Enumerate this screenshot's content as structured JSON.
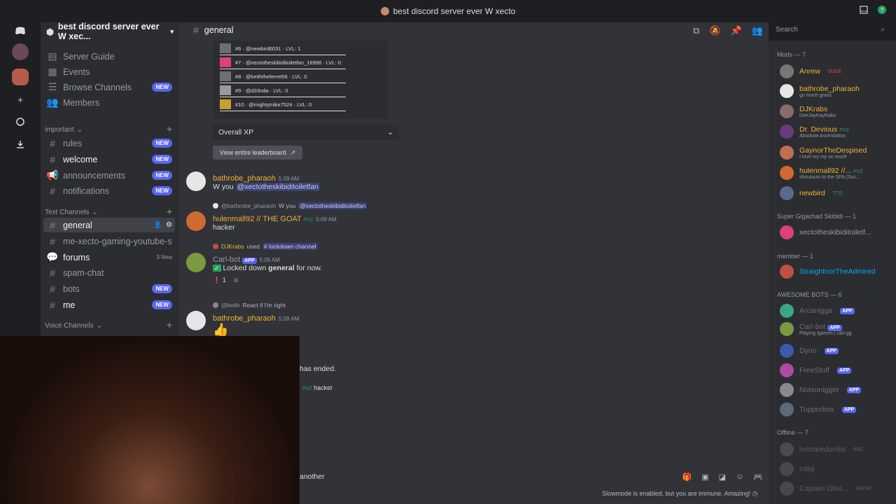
{
  "window": {
    "title": "best discord server ever W xecto"
  },
  "server": {
    "name": "best discord server ever W xec...",
    "items": [
      "Server Guide",
      "Events",
      "Browse Channels",
      "Members"
    ],
    "new_label": "NEW"
  },
  "categories": {
    "important": "important",
    "text": "Text Channels",
    "voice": "Voice Channels"
  },
  "channels": [
    {
      "name": "rules",
      "badge": "NEW"
    },
    {
      "name": "welcome",
      "badge": "NEW"
    },
    {
      "name": "announcements",
      "badge": "NEW"
    },
    {
      "name": "notifications",
      "badge": "NEW"
    },
    {
      "name": "general",
      "badge": ""
    },
    {
      "name": "me-xecto-gaming-youtube-stre...",
      "badge": ""
    },
    {
      "name": "forums",
      "badge": "3 New"
    },
    {
      "name": "spam-chat",
      "badge": ""
    },
    {
      "name": "bots",
      "badge": "NEW"
    },
    {
      "name": "me",
      "badge": "NEW"
    }
  ],
  "header": {
    "channel": "general",
    "search_placeholder": "Search"
  },
  "leaderboard": {
    "rows": [
      "#6 · @newbird6031 · LVL: 1",
      "#7 · @xectotheskibiditoiletfan_16998 · LVL: 0",
      "#8 · @keiththeferret56 · LVL: 0",
      "#9 · @d33nda · LVL: 0",
      "#10 · @mightymike7524 · LVL: 0"
    ],
    "select": "Overall XP",
    "button": "View entire leaderboard"
  },
  "messages": {
    "m1": {
      "user": "bathrobe_pharaoh",
      "time": "5:09 AM",
      "text": "W you",
      "mention": "@xectotheskibiditoiletfan"
    },
    "m2": {
      "reply_user": "@bathrobe_pharaoh",
      "reply_text": "W you",
      "reply_mention": "@xectotheskibiditoiletfan",
      "user": "hulenmall92 // THE GOAT",
      "tag": "PVZ",
      "time": "5:09 AM",
      "text": "hacker"
    },
    "m3": {
      "reply_user": "DJKrabs",
      "reply_used": "used",
      "reply_cmd": "# lockdown channel",
      "user": "Carl-bot",
      "app": "APP",
      "time": "5:09 AM",
      "text_pre": "Locked down",
      "text_bold": "general",
      "text_post": "for now.",
      "reaction": "1"
    },
    "m4": {
      "reply_user": "@keith",
      "reply_text": "React if I'm right",
      "user": "bathrobe_pharaoh",
      "time": "5:09 AM"
    },
    "m5": {
      "text": "has ended."
    },
    "m6": {
      "tag": "PVZ",
      "text": "hacker"
    }
  },
  "composer": {
    "text": "another"
  },
  "slowmode": "Slowmode is enabled, but you are immune. Amazing!",
  "members": {
    "groups": [
      "Mods — 7",
      "Super Gigachad Skibidi — 1",
      "member — 1",
      "AWESOME BOTS — 6",
      "Offline — 7"
    ],
    "mods": [
      {
        "name": "Anrew",
        "extra": "DUDE",
        "color": "#f0b232",
        "sub": ""
      },
      {
        "name": "bathrobe_pharaoh",
        "extra": "",
        "color": "#f0b232",
        "sub": "go touch grass"
      },
      {
        "name": "DJKrabs",
        "extra": "",
        "color": "#f0b232",
        "sub": "DeeJayKayRabs"
      },
      {
        "name": "Dr. Devious",
        "extra": "PVZ",
        "color": "#f0b232",
        "sub": "Absolute Assimilation"
      },
      {
        "name": "GaynorTheDespised",
        "extra": "",
        "color": "#f0b232",
        "sub": "I love my my so much"
      },
      {
        "name": "hulenmall92 //...",
        "extra": "PVZ",
        "color": "#f0b232",
        "sub": "shoutouts to the SPA (Soc..."
      },
      {
        "name": "newbird",
        "extra": "TTD",
        "color": "#f0b232",
        "sub": ""
      }
    ],
    "giga": {
      "name": "xectotheskibiditoiletf...",
      "color": "#949ba4"
    },
    "member": {
      "name": "StraightnorTheAdmired",
      "color": "#00a8fc"
    },
    "bots": [
      {
        "name": "Arcanigga",
        "sub": ""
      },
      {
        "name": "Carl-bot",
        "sub": "Playing /games | carl.gg"
      },
      {
        "name": "Dyno",
        "sub": ""
      },
      {
        "name": "FreeStuff",
        "sub": ""
      },
      {
        "name": "Notsonigger",
        "sub": ""
      },
      {
        "name": "Tupperbox",
        "sub": ""
      }
    ],
    "offline": [
      {
        "name": "hotsaredumbs",
        "extra": "BBC"
      },
      {
        "name": "cabji",
        "extra": ""
      },
      {
        "name": "Captain Obvi...",
        "extra": "MEOW"
      }
    ],
    "app_label": "APP"
  }
}
